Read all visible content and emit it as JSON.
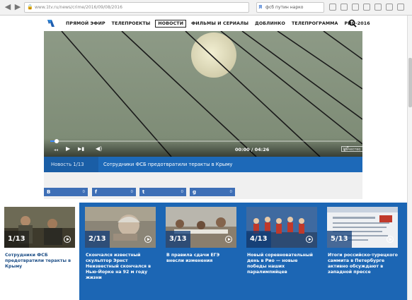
{
  "browser": {
    "url": "www.1tv.ru/news/crime/2016/09/08/2016",
    "search_text": "фсб путин нарко"
  },
  "header": {
    "nav": [
      {
        "label": "ПРЯМОЙ ЭФИР",
        "active": false
      },
      {
        "label": "ТЕЛЕПРОЕКТЫ",
        "active": false
      },
      {
        "label": "НОВОСТИ",
        "active": true
      },
      {
        "label": "ФИЛЬМЫ И СЕРИАЛЫ",
        "active": false
      },
      {
        "label": "ДОБЛИНКО",
        "active": false
      },
      {
        "label": "ТЕЛЕПРОГРАММА",
        "active": false
      },
      {
        "label": "РИО-2016",
        "active": false
      }
    ]
  },
  "player": {
    "time": "00:00 / 04:26",
    "quality": "Качество",
    "progress": 0.02
  },
  "caption": {
    "count": "Новость 1/13",
    "text": "Сотрудники ФСБ предотвратили теракты в Крыму"
  },
  "shares": [
    {
      "icon": "В",
      "count": "0"
    },
    {
      "icon": "f",
      "count": "0"
    },
    {
      "icon": "t",
      "count": "0"
    },
    {
      "icon": "g",
      "count": "0"
    }
  ],
  "cards": [
    {
      "num": "1/13",
      "title": "Сотрудники ФСБ предотвратили теракты в Крыму",
      "active": true
    },
    {
      "num": "2/13",
      "title": "Скончался известный скульптор Эрнст Неизвестный скончался в Нью-Йорке на 92 м году жизни",
      "active": false
    },
    {
      "num": "3/13",
      "title": "В правила сдачи ЕГЭ внесли изменения",
      "active": false
    },
    {
      "num": "4/13",
      "title": "Новый соревновательный день в Рио — новые победы наших паралимпийцев",
      "active": false
    },
    {
      "num": "5/13",
      "title": "Итоги российско-турецкого саммита в Петербурге активно обсуждают в западной прессе",
      "active": false
    }
  ],
  "colors": {
    "brand_blue": "#1c66b4",
    "accent": "#3d8bff"
  }
}
